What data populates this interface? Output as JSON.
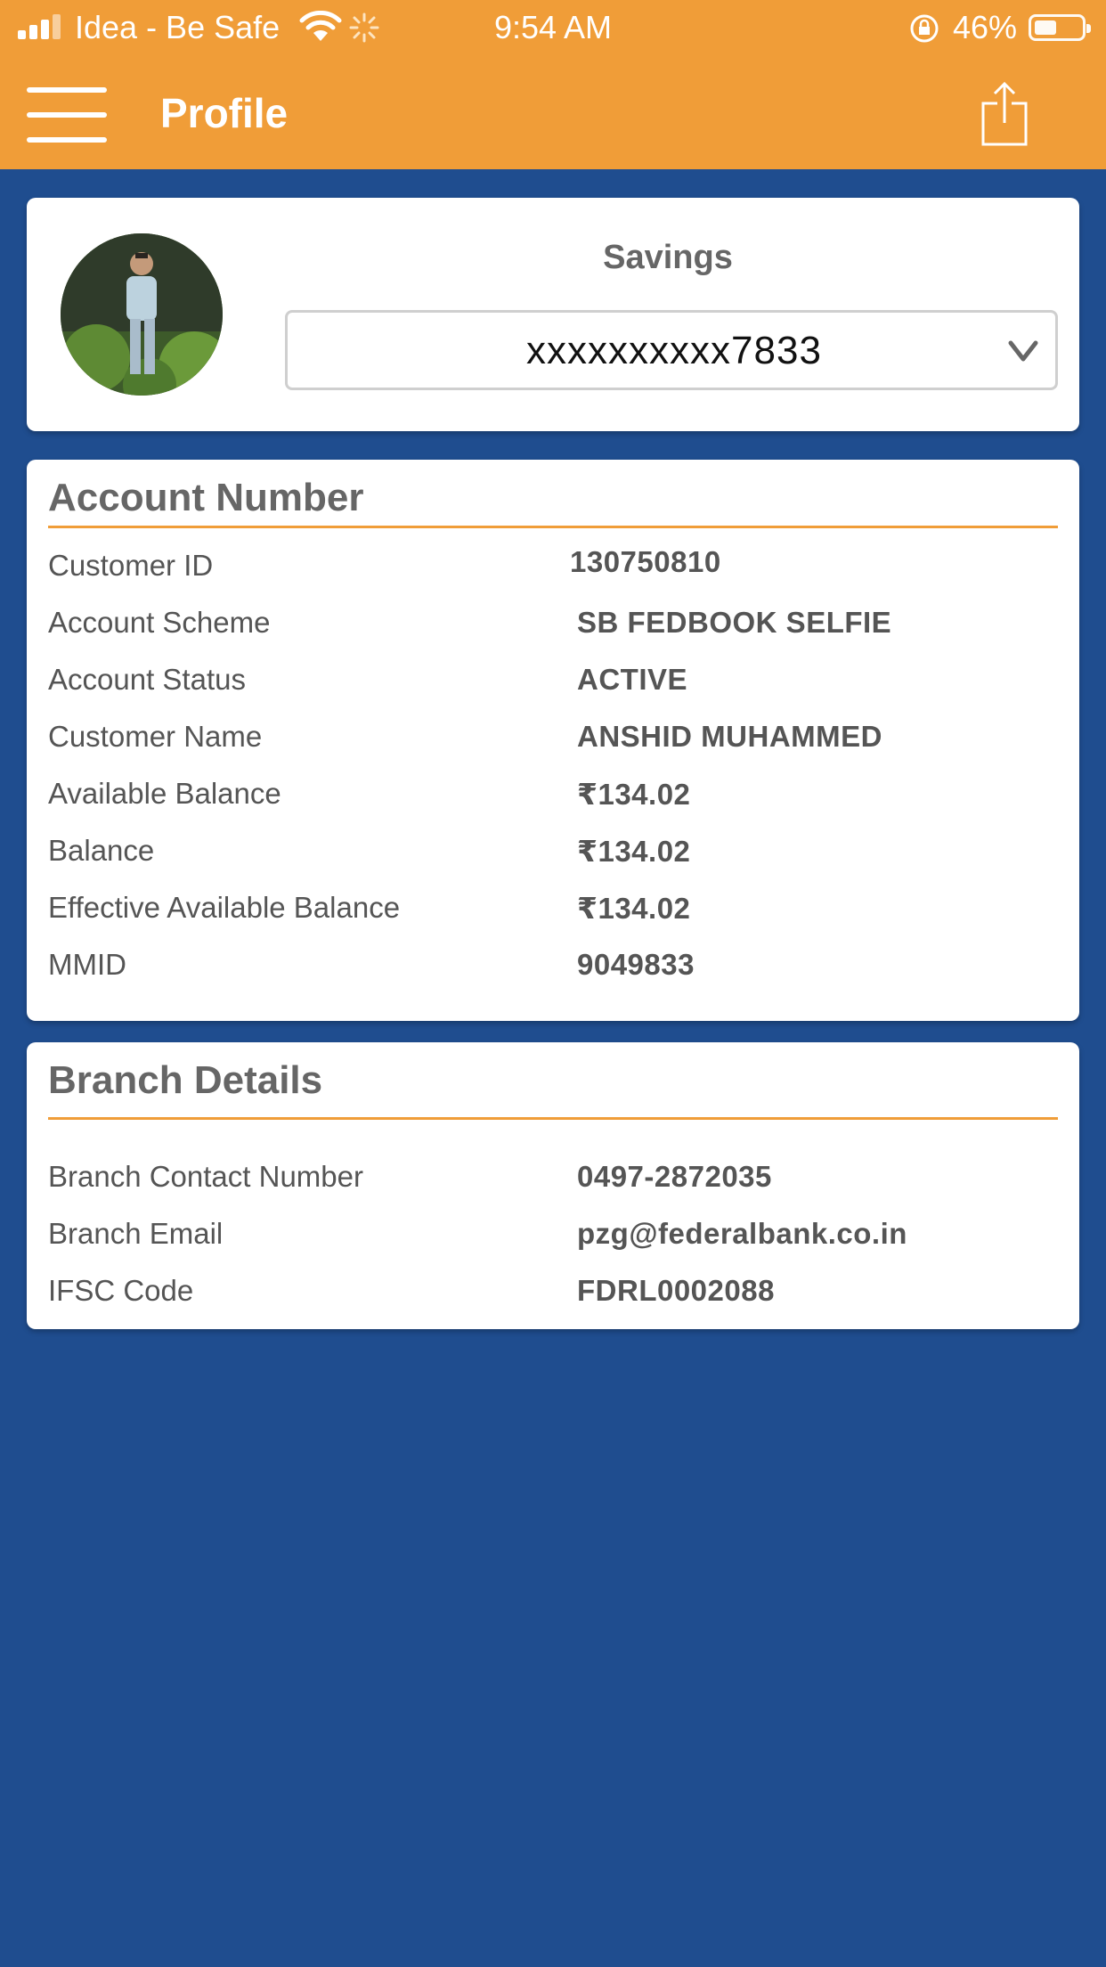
{
  "status_bar": {
    "carrier": "Idea - Be Safe",
    "time": "9:54 AM",
    "battery": "46%",
    "battery_level": 0.46,
    "icons": [
      "signal-icon",
      "wifi-icon",
      "activity-spinner-icon",
      "rotation-lock-icon",
      "battery-icon"
    ]
  },
  "nav": {
    "title": "Profile",
    "icons": [
      "hamburger-menu-icon",
      "share-icon"
    ]
  },
  "account_card": {
    "account_type": "Savings",
    "selected_account": "xxxxxxxxxx7833",
    "icons": [
      "chevron-down-icon"
    ]
  },
  "account_section": {
    "title": "Account Number",
    "rows": [
      {
        "label": "Customer ID",
        "value": "130750810"
      },
      {
        "label": "Account Scheme",
        "value": "SB FEDBOOK SELFIE"
      },
      {
        "label": "Account Status",
        "value": "ACTIVE"
      },
      {
        "label": "Customer Name",
        "value": "ANSHID MUHAMMED"
      },
      {
        "label": "Available Balance",
        "value": "₹134.02"
      },
      {
        "label": "Balance",
        "value": "₹134.02"
      },
      {
        "label": "Effective Available Balance",
        "value": "₹134.02"
      },
      {
        "label": "MMID",
        "value": "9049833"
      }
    ]
  },
  "branch_section": {
    "title": "Branch Details",
    "rows": [
      {
        "label": "Branch Contact Number",
        "value": "0497-2872035"
      },
      {
        "label": "Branch Email",
        "value": "pzg@federalbank.co.in"
      },
      {
        "label": "IFSC Code",
        "value": "FDRL0002088"
      }
    ]
  },
  "colors": {
    "header": "#f09d38",
    "background": "#1f4d8f",
    "card": "#ffffff",
    "accent_rule": "#f09d38"
  }
}
